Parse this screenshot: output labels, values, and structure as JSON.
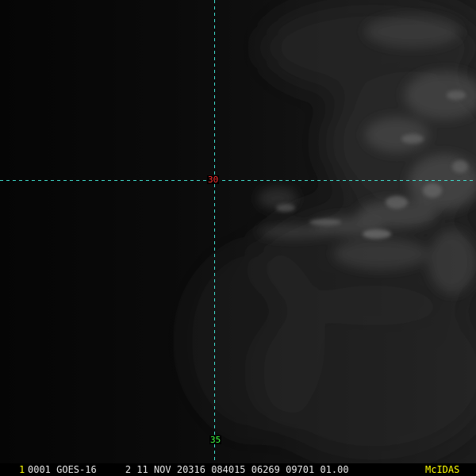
{
  "frame": {
    "number": "1",
    "number_color": "#ffff00"
  },
  "status": {
    "text": "0001 GOES-16     2 11 NOV 20316 084015 06269 09701 01.00",
    "color": "#e6e6e6"
  },
  "brand": {
    "label": "McIDAS",
    "color": "#ffff00"
  },
  "grid": {
    "line_color": "#40e0d0",
    "labels": [
      {
        "text": "30",
        "color": "#ff3030"
      },
      {
        "text": "35",
        "color": "#40ff40"
      }
    ]
  }
}
